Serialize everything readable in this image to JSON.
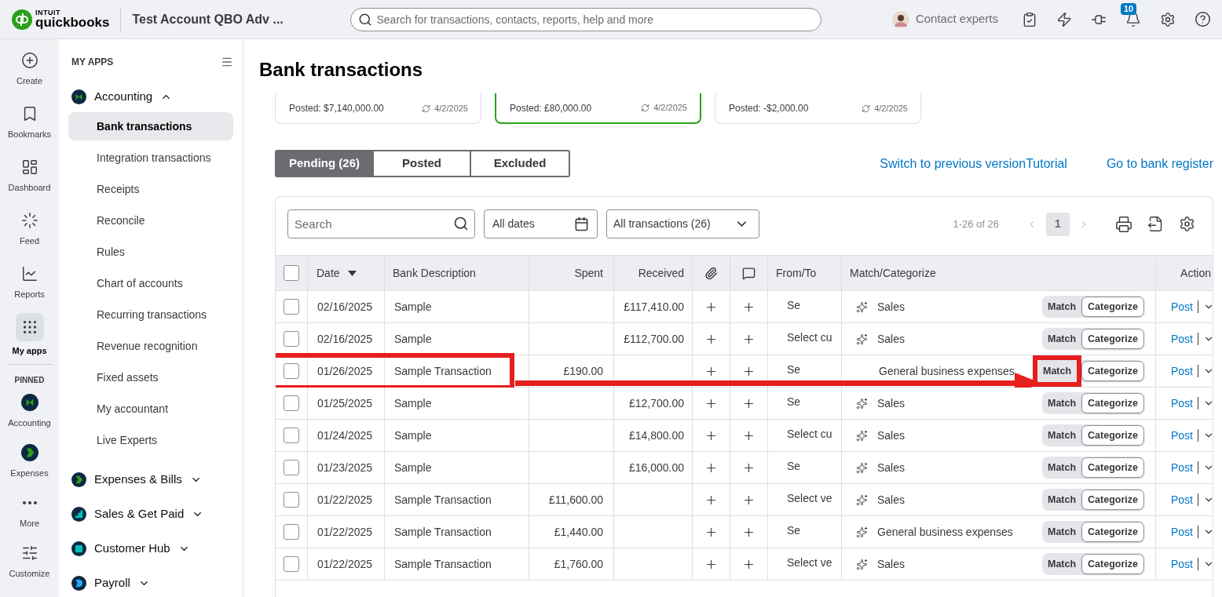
{
  "topbar": {
    "brand_top": "INTUIT",
    "brand": "quickbooks",
    "company": "Test Account QBO Adv ...",
    "search_placeholder": "Search for transactions, contacts, reports, help and more",
    "contact": "Contact experts",
    "notification_count": "10"
  },
  "rail": {
    "items": [
      {
        "label": "Create",
        "kind": "create",
        "selected": false
      },
      {
        "label": "Bookmarks",
        "kind": "bookmarks",
        "selected": false
      },
      {
        "label": "Dashboard",
        "kind": "dashboard",
        "selected": false
      },
      {
        "label": "Feed",
        "kind": "feed",
        "selected": false
      },
      {
        "label": "Reports",
        "kind": "reports",
        "selected": false
      },
      {
        "label": "My apps",
        "kind": "apps",
        "selected": true
      }
    ],
    "pinned_label": "PINNED",
    "pinned": [
      {
        "label": "Accounting",
        "kind": "accounting"
      },
      {
        "label": "Expenses",
        "kind": "expenses"
      },
      {
        "label": "More",
        "kind": "more"
      },
      {
        "label": "Customize",
        "kind": "customize"
      }
    ]
  },
  "sidebar": {
    "heading": "MY APPS",
    "apps": [
      {
        "label": "Accounting",
        "kind": "accounting",
        "expanded": true,
        "children": [
          {
            "label": "Bank transactions",
            "selected": true
          },
          {
            "label": "Integration transactions",
            "selected": false
          },
          {
            "label": "Receipts",
            "selected": false
          },
          {
            "label": "Reconcile",
            "selected": false
          },
          {
            "label": "Rules",
            "selected": false
          },
          {
            "label": "Chart of accounts",
            "selected": false
          },
          {
            "label": "Recurring transactions",
            "selected": false
          },
          {
            "label": "Revenue recognition",
            "selected": false
          },
          {
            "label": "Fixed assets",
            "selected": false
          },
          {
            "label": "My accountant",
            "selected": false
          },
          {
            "label": "Live Experts",
            "selected": false
          }
        ]
      },
      {
        "label": "Expenses & Bills",
        "kind": "expenses",
        "expanded": false
      },
      {
        "label": "Sales & Get Paid",
        "kind": "sales",
        "expanded": false
      },
      {
        "label": "Customer Hub",
        "kind": "customers",
        "expanded": false
      },
      {
        "label": "Payroll",
        "kind": "payroll",
        "expanded": false
      }
    ]
  },
  "main": {
    "title": "Bank transactions",
    "accounts": [
      {
        "posted": "Posted: $7,140,000.00",
        "synced": "4/2/2025",
        "selected": false
      },
      {
        "posted": "Posted: £80,000.00",
        "synced": "4/2/2025",
        "selected": true
      },
      {
        "posted": "Posted: -$2,000.00",
        "synced": "4/2/2025",
        "selected": false
      }
    ],
    "tabs": [
      {
        "label": "Pending (26)",
        "selected": true
      },
      {
        "label": "Posted",
        "selected": false
      },
      {
        "label": "Excluded",
        "selected": false
      }
    ],
    "links": [
      "Switch to previous version",
      "Tutorial"
    ],
    "register_link": "Go to bank register",
    "toolbar": {
      "search_placeholder": "Search",
      "dates": "All dates",
      "filter": "All transactions (26)",
      "range": "1-26 of 26",
      "page": "1"
    },
    "table": {
      "all_checked": false,
      "columns": [
        {
          "label": "Date",
          "sorted": true
        },
        {
          "label": "Bank Description",
          "sorted": false
        },
        {
          "label": "Spent",
          "sorted": false
        },
        {
          "label": "Received",
          "sorted": false
        },
        {
          "label": "From/To",
          "sorted": false
        },
        {
          "label": "Match/Categorize",
          "sorted": false
        },
        {
          "label": "Action",
          "sorted": false
        }
      ],
      "rows": [
        {
          "checked": false,
          "date": "02/16/2025",
          "description": "Sample",
          "spent": "",
          "received": "£117,410.00",
          "from_to": "Se",
          "category": "Sales",
          "suggested": true,
          "highlighted": false,
          "match": "Match",
          "categorize": "Categorize",
          "action": "Post"
        },
        {
          "checked": false,
          "date": "02/16/2025",
          "description": "Sample",
          "spent": "",
          "received": "£112,700.00",
          "from_to": "Select cu",
          "category": "Sales",
          "suggested": true,
          "highlighted": false,
          "match": "Match",
          "categorize": "Categorize",
          "action": "Post"
        },
        {
          "checked": false,
          "date": "01/26/2025",
          "description": "Sample Transaction",
          "spent": "£190.00",
          "received": "",
          "from_to": "Se",
          "category": "General business expenses",
          "suggested": false,
          "highlighted": true,
          "match": "Match",
          "categorize": "Categorize",
          "action": "Post"
        },
        {
          "checked": false,
          "date": "01/25/2025",
          "description": "Sample",
          "spent": "",
          "received": "£12,700.00",
          "from_to": "Se",
          "category": "Sales",
          "suggested": true,
          "highlighted": false,
          "match": "Match",
          "categorize": "Categorize",
          "action": "Post"
        },
        {
          "checked": false,
          "date": "01/24/2025",
          "description": "Sample",
          "spent": "",
          "received": "£14,800.00",
          "from_to": "Select cu",
          "category": "Sales",
          "suggested": true,
          "highlighted": false,
          "match": "Match",
          "categorize": "Categorize",
          "action": "Post"
        },
        {
          "checked": false,
          "date": "01/23/2025",
          "description": "Sample",
          "spent": "",
          "received": "£16,000.00",
          "from_to": "Se",
          "category": "Sales",
          "suggested": true,
          "highlighted": false,
          "match": "Match",
          "categorize": "Categorize",
          "action": "Post"
        },
        {
          "checked": false,
          "date": "01/22/2025",
          "description": "Sample Transaction",
          "spent": "£11,600.00",
          "received": "",
          "from_to": "Select ve",
          "category": "Sales",
          "suggested": true,
          "highlighted": false,
          "match": "Match",
          "categorize": "Categorize",
          "action": "Post"
        },
        {
          "checked": false,
          "date": "01/22/2025",
          "description": "Sample Transaction",
          "spent": "£1,440.00",
          "received": "",
          "from_to": "Se",
          "category": "General business expenses",
          "suggested": true,
          "highlighted": false,
          "match": "Match",
          "categorize": "Categorize",
          "action": "Post"
        },
        {
          "checked": false,
          "date": "01/22/2025",
          "description": "Sample Transaction",
          "spent": "£1,760.00",
          "received": "",
          "from_to": "Select ve",
          "category": "Sales",
          "suggested": true,
          "highlighted": false,
          "match": "Match",
          "categorize": "Categorize",
          "action": "Post"
        }
      ]
    }
  }
}
